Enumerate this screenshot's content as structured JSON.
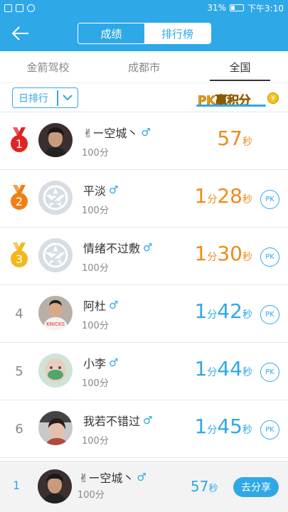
{
  "status_bar": {
    "battery": "31%",
    "time": "下午3:10"
  },
  "header": {
    "segments": [
      "成绩",
      "排行榜"
    ],
    "active_segment": 1
  },
  "tabs": [
    "金箭驾校",
    "成都市",
    "全国"
  ],
  "filter": {
    "period": "日排行",
    "badge": "PK赢积分"
  },
  "rows": [
    {
      "rank": "1",
      "name": "✌ー空城丶",
      "gender": "♂",
      "score": "100分",
      "time_parts": [
        "57",
        "秒"
      ],
      "pk": "",
      "medal_color": "#e02424",
      "avatar": "photo1"
    },
    {
      "rank": "2",
      "name": "平淡",
      "gender": "♂",
      "score": "100分",
      "time_parts": [
        "1",
        "分",
        "28",
        "秒"
      ],
      "pk": "PK",
      "medal_color": "#f07f14",
      "avatar": "default"
    },
    {
      "rank": "3",
      "name": "情绪不过敷",
      "gender": "♂",
      "score": "100分",
      "time_parts": [
        "1",
        "分",
        "30",
        "秒"
      ],
      "pk": "PK",
      "medal_color": "#f3b71a",
      "avatar": "default"
    },
    {
      "rank": "4",
      "name": "阿杜",
      "gender": "♂",
      "score": "100分",
      "time_parts": [
        "1",
        "分",
        "42",
        "秒"
      ],
      "pk": "PK",
      "avatar": "photo2"
    },
    {
      "rank": "5",
      "name": "小李",
      "gender": "♂",
      "score": "100分",
      "time_parts": [
        "1",
        "分",
        "44",
        "秒"
      ],
      "pk": "PK",
      "avatar": "photo3"
    },
    {
      "rank": "6",
      "name": "我若不错过",
      "gender": "♂",
      "score": "100分",
      "time_parts": [
        "1",
        "分",
        "45",
        "秒"
      ],
      "pk": "PK",
      "avatar": "photo4"
    }
  ],
  "me": {
    "rank": "1",
    "name": "✌ー空城丶",
    "gender": "♂",
    "score": "100分",
    "time_parts": [
      "57",
      "秒"
    ],
    "share": "去分享"
  },
  "colors": {
    "primary": "#2fa8e8",
    "orange": "#f08a1c"
  }
}
